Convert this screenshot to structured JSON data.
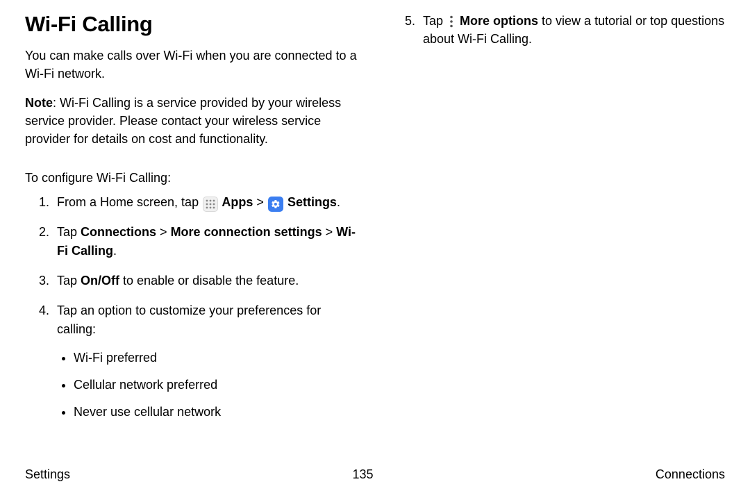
{
  "title": "Wi-Fi Calling",
  "intro1": "You can make calls over Wi-Fi when you are connected to a Wi-Fi network.",
  "note_label": "Note",
  "note_text": ": Wi-Fi Calling is a service provided by your wireless service provider. Please contact your wireless service provider for details on cost and functionality.",
  "configure_lead": "To configure Wi-Fi Calling:",
  "step1_pre": "From a Home screen, tap ",
  "step1_apps": " Apps",
  "step1_sep": " > ",
  "step1_settings": " Settings",
  "step1_end": ".",
  "step2_pre": "Tap ",
  "step2_b1": "Connections",
  "step2_b2": "More connection settings",
  "step2_b3": "Wi-Fi Calling",
  "step2_sep": " > ",
  "step2_end": ".",
  "step3_pre": "Tap ",
  "step3_b": "On/Off",
  "step3_post": " to enable or disable the feature.",
  "step4": "Tap an option to customize your preferences for calling:",
  "opt1": "Wi-Fi preferred",
  "opt2": "Cellular network preferred",
  "opt3": "Never use cellular network",
  "step5_pre": "Tap ",
  "step5_b": " More options",
  "step5_post": " to view a tutorial or top questions about Wi-Fi Calling.",
  "footer_left": "Settings",
  "footer_center": "135",
  "footer_right": "Connections"
}
